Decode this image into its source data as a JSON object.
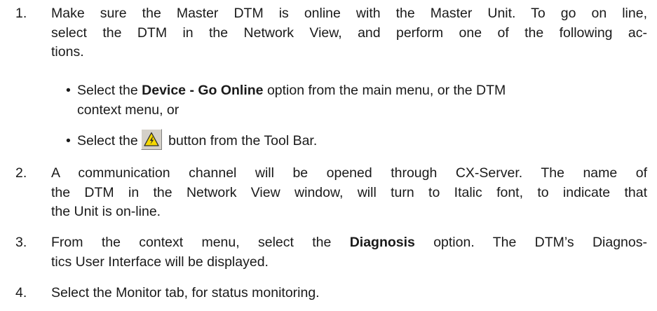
{
  "steps": [
    {
      "number": "1.",
      "lines": [
        "Make sure the Master DTM is online with the Master Unit. To go on line,",
        "select the DTM in the Network View, and perform one of the following ac-",
        "tions."
      ],
      "bullets": [
        {
          "pre": "Select the ",
          "bold": "Device - Go Online",
          "post_line1": " option from the main menu, or the DTM",
          "line2": "context menu, or"
        },
        {
          "pre": "Select the",
          "post": " button from the Tool Bar.",
          "icon": "go-online-warning-icon"
        }
      ]
    },
    {
      "number": "2.",
      "lines": [
        "A communication channel will be opened through CX-Server. The name of",
        "the DTM in the Network View window, will turn to Italic font, to indicate that",
        "the Unit is on-line."
      ]
    },
    {
      "number": "3.",
      "pre": "From the context menu, select the ",
      "bold": "Diagnosis",
      "post_line1": " option. The DTM’s Diagnos-",
      "line2": "tics User Interface will be displayed."
    },
    {
      "number": "4.",
      "line1": "Select the Monitor tab, for status monitoring."
    }
  ],
  "bullet_char": "•",
  "colors": {
    "text": "#1a1a1a",
    "icon_yellow": "#f5d800",
    "icon_border": "#2a2a2a"
  }
}
